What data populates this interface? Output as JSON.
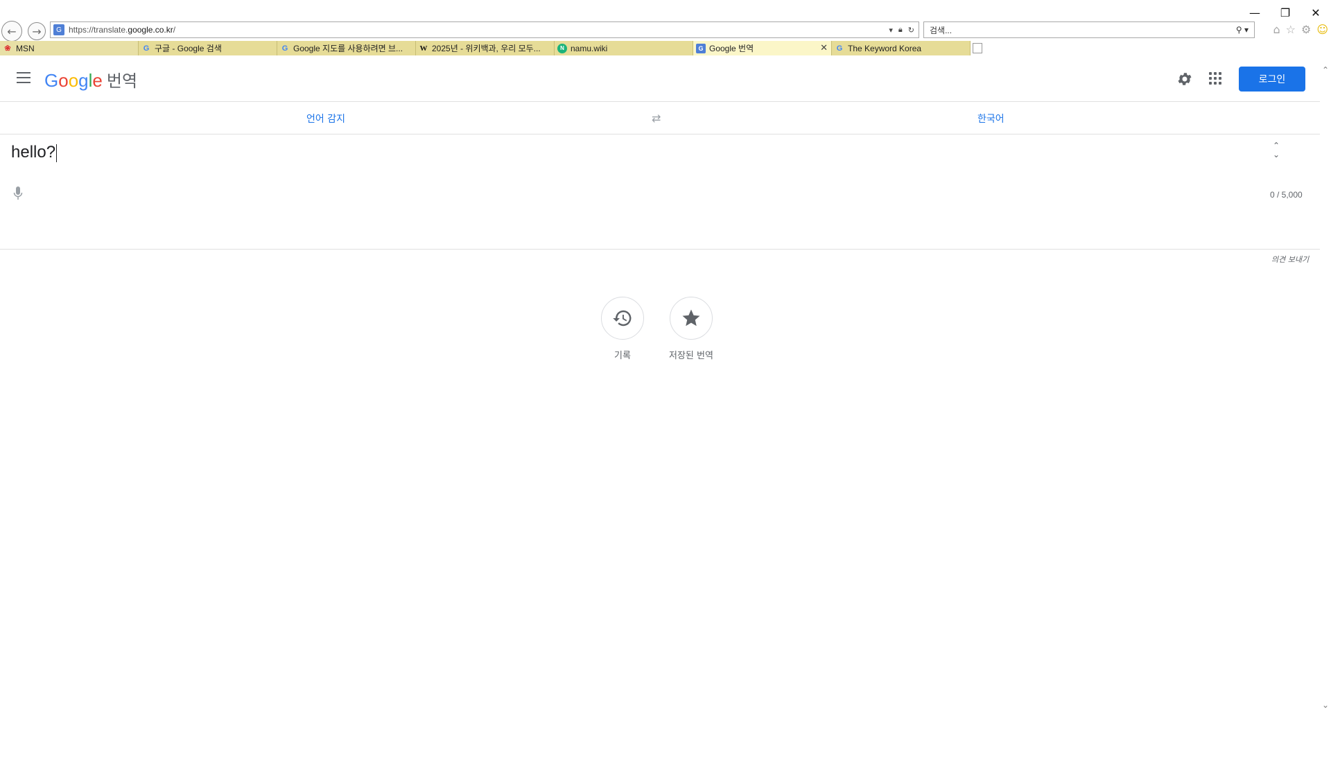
{
  "browser": {
    "url_prefix": "https://translate.",
    "url_domain": "google.co.kr",
    "url_suffix": "/",
    "search_placeholder": "검색...",
    "tabs": [
      {
        "label": "MSN",
        "favicon": "msn-icon"
      },
      {
        "label": "구글 - Google 검색",
        "favicon": "google-g-icon"
      },
      {
        "label": "Google 지도를 사용하려면 브...",
        "favicon": "google-g-icon"
      },
      {
        "label": "2025년 - 위키백과, 우리 모두...",
        "favicon": "wikipedia-icon"
      },
      {
        "label": "namu.wiki",
        "favicon": "namu-icon"
      },
      {
        "label": "Google 번역",
        "favicon": "translate-icon",
        "active": true
      },
      {
        "label": "The Keyword Korea",
        "favicon": "google-g-icon"
      }
    ]
  },
  "header": {
    "logo_letters": [
      "G",
      "o",
      "o",
      "g",
      "l",
      "e"
    ],
    "product_name": "번역",
    "login_label": "로그인"
  },
  "languages": {
    "source": "언어 감지",
    "target": "한국어"
  },
  "input": {
    "text": "hello?",
    "char_count": "0 / 5,000"
  },
  "feedback_label": "의견 보내기",
  "actions": {
    "history_label": "기록",
    "saved_label": "저장된 번역"
  },
  "colors": {
    "accent": "#1a73e8",
    "tab_bg": "#e6dc97",
    "tab_active_bg": "#fbf6c8"
  }
}
